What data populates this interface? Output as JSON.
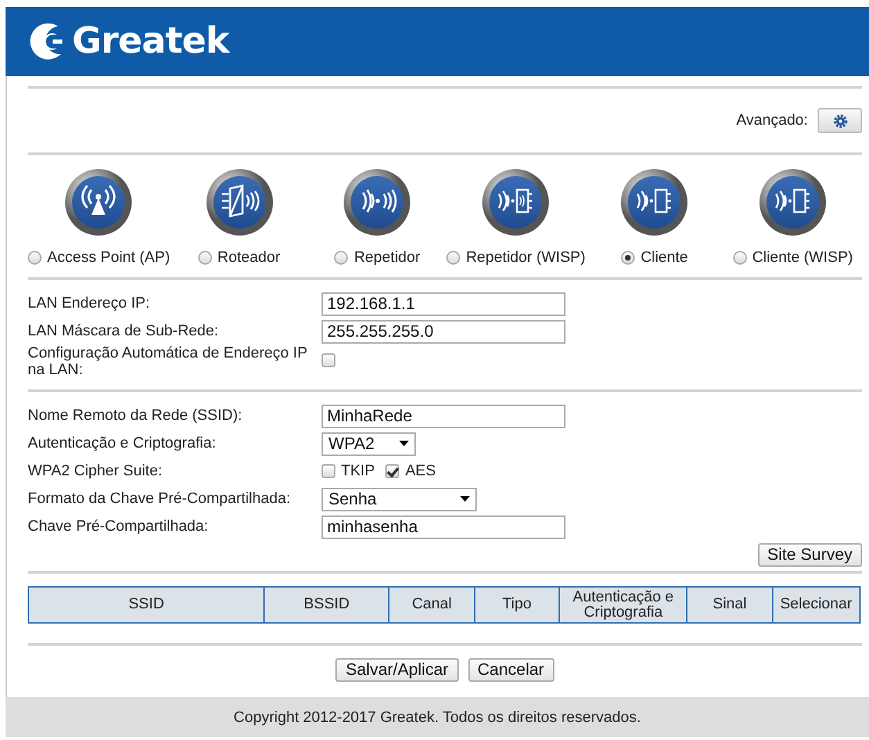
{
  "header": {
    "logo_text": "Greatek"
  },
  "advanced": {
    "label": "Avançado:"
  },
  "modes": [
    {
      "label": "Access Point (AP)",
      "selected": false
    },
    {
      "label": "Roteador",
      "selected": false
    },
    {
      "label": "Repetidor",
      "selected": false
    },
    {
      "label": "Repetidor (WISP)",
      "selected": false
    },
    {
      "label": "Cliente",
      "selected": true
    },
    {
      "label": "Cliente (WISP)",
      "selected": false
    }
  ],
  "lan_fields": [
    {
      "label": "LAN Endereço IP:",
      "kind": "text",
      "value": "192.168.1.1"
    },
    {
      "label": "LAN Máscara de Sub-Rede:",
      "kind": "text",
      "value": "255.255.255.0"
    },
    {
      "label": "Configuração Automática de Endereço IP na LAN:",
      "kind": "checkbox",
      "checked": false
    }
  ],
  "wireless_fields": [
    {
      "label": "Nome Remoto da Rede (SSID):",
      "kind": "text",
      "value": "MinhaRede"
    },
    {
      "label": "Autenticação e Criptografia:",
      "kind": "select",
      "value": "WPA2"
    },
    {
      "label": "WPA2 Cipher Suite:",
      "kind": "checks",
      "options": [
        {
          "label": "TKIP",
          "checked": false
        },
        {
          "label": "AES",
          "checked": true
        }
      ]
    },
    {
      "label": "Formato da Chave Pré-Compartilhada:",
      "kind": "select",
      "value": "Senha"
    },
    {
      "label": "Chave Pré-Compartilhada:",
      "kind": "text",
      "value": "minhasenha"
    }
  ],
  "site_survey_button": "Site Survey",
  "survey_table": {
    "columns": [
      "SSID",
      "BSSID",
      "Canal",
      "Tipo",
      "Autenticação e Criptografia",
      "Sinal",
      "Selecionar"
    ]
  },
  "buttons": [
    "Salvar/Aplicar",
    "Cancelar"
  ],
  "footer": "Copyright 2012-2017 Greatek. Todos os direitos reservados."
}
